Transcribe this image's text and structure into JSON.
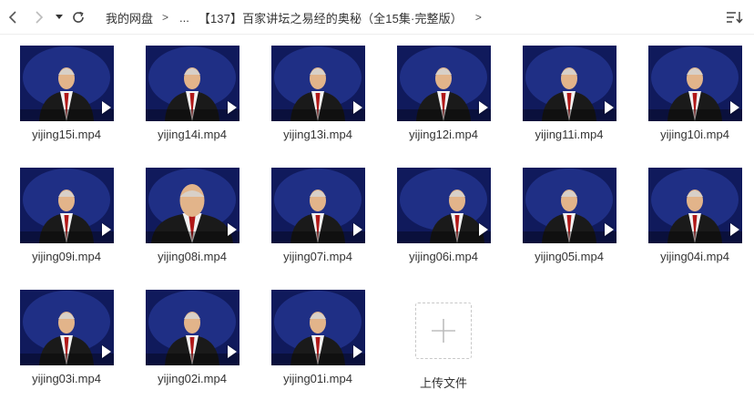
{
  "toolbar": {
    "back_icon": "chevron-left-icon",
    "forward_icon": "chevron-right-icon",
    "history_icon": "caret-down-icon",
    "refresh_icon": "refresh-icon",
    "sort_icon": "sort-list-icon"
  },
  "breadcrumb": {
    "root": "我的网盘",
    "separator": ">",
    "ellipsis": "...",
    "current": "【137】百家讲坛之易经的奥秘（全15集·完整版）"
  },
  "files": [
    {
      "name": "yijing15i.mp4"
    },
    {
      "name": "yijing14i.mp4"
    },
    {
      "name": "yijing13i.mp4"
    },
    {
      "name": "yijing12i.mp4"
    },
    {
      "name": "yijing11i.mp4"
    },
    {
      "name": "yijing10i.mp4"
    },
    {
      "name": "yijing09i.mp4"
    },
    {
      "name": "yijing08i.mp4"
    },
    {
      "name": "yijing07i.mp4"
    },
    {
      "name": "yijing06i.mp4"
    },
    {
      "name": "yijing05i.mp4"
    },
    {
      "name": "yijing04i.mp4"
    },
    {
      "name": "yijing03i.mp4"
    },
    {
      "name": "yijing02i.mp4"
    },
    {
      "name": "yijing01i.mp4"
    }
  ],
  "upload": {
    "label": "上传文件",
    "icon": "plus-icon"
  },
  "colors": {
    "thumb_bg": "#101a5c",
    "suit": "#1a1a1a",
    "tie": "#b01818",
    "shirt": "#f2f2f2",
    "skin": "#e2b48a",
    "icon": "#666666"
  }
}
